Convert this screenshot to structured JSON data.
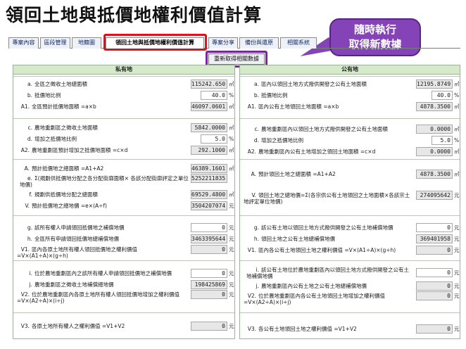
{
  "title": "領回土地與抵價地權利價值計算",
  "tabs": [
    "專案內容",
    "區段管理",
    "地籍圖",
    "領回土地與抵價地權利價值計算",
    "專案分享",
    "備份與還原",
    "相關系統"
  ],
  "callout": {
    "line1": "隨時執行",
    "line2": "取得新數據"
  },
  "refresh_button": "重新取得相關數據",
  "left": {
    "title": "私有地",
    "rows": [
      {
        "code": "a.",
        "label": "全區之徵收土地總面積",
        "value": "115242.650",
        "unit": "㎡"
      },
      {
        "code": "b.",
        "label": "抵價地比例",
        "value": "40.0",
        "unit": "%"
      },
      {
        "code": "A1.",
        "label": "全區預計抵價地面積 =a×b",
        "value": "46097.0601",
        "unit": "㎡"
      },
      {
        "code": "c.",
        "label": "農地重劃區之徵收土地面積",
        "value": "5842.0000",
        "unit": "㎡"
      },
      {
        "code": "d.",
        "label": "增加之抵價地比例",
        "value": "5.0",
        "unit": "%"
      },
      {
        "code": "A2.",
        "label": "農地重劃區預計增加之抵價地面積 =c×d",
        "value": "292.1000",
        "unit": "㎡"
      },
      {
        "code": "A.",
        "label": "預計抵價地之總面積 =A1+A2",
        "value": "46389.1601",
        "unit": "㎡"
      },
      {
        "code": "e.",
        "label": "Σ(規劃供抵價地分配之各分配街廓面積× 各該分配街廓評定之單位地價)",
        "value": "5252211835",
        "unit": ""
      },
      {
        "code": "f.",
        "label": "規劃供抵價地分配之總面積",
        "value": "69529.4800",
        "unit": "㎡"
      },
      {
        "code": "V.",
        "label": "預計抵價地之總地價 =e×(A÷f)",
        "value": "3504207074",
        "unit": "元"
      },
      {
        "code": "g.",
        "label": "該所有權人申請領回抵價地之補償地價",
        "value": "0",
        "unit": "元"
      },
      {
        "code": "h.",
        "label": "全區所有申請領回抵價地總補償地價",
        "value": "3463395644",
        "unit": "元"
      },
      {
        "code": "V1.",
        "label": "區內各原土地所有權人領回抵價地之權利價值 =V×(A1÷A)×(g÷h)",
        "value": "0",
        "unit": "元"
      },
      {
        "code": "i.",
        "label": "位於農地重劃區內之該所有權人申請領回抵價地之補償地價",
        "value": "0",
        "unit": "元"
      },
      {
        "code": "j.",
        "label": "農地重劃區之徵收土地補償總地價",
        "value": "198425869",
        "unit": "元"
      },
      {
        "code": "V2.",
        "label": "位於農地重劃區內各原土地所有權人領回抵價地增加之權利價值 =V×(A2÷A)×(i÷j)",
        "value": "0",
        "unit": "元"
      },
      {
        "code": "V3.",
        "label": "各原土地所有權人之權利價值 =V1+V2",
        "value": "0",
        "unit": "元"
      }
    ]
  },
  "right": {
    "title": "公有地",
    "rows": [
      {
        "code": "a.",
        "label": "區內以領回土地方式撥供開發之公有土地面積",
        "value": "12195.8749",
        "unit": "㎡"
      },
      {
        "code": "b.",
        "label": "抵價地比例",
        "value": "40.0",
        "unit": "%"
      },
      {
        "code": "A1.",
        "label": "區內公有土地領回土地面積 =a×b",
        "value": "4878.3500",
        "unit": "㎡"
      },
      {
        "code": "c.",
        "label": "農地重劃區內以領回土地方式撥供開發之公有土地面積",
        "value": "0.0000",
        "unit": "㎡"
      },
      {
        "code": "d.",
        "label": "增加之抵價地比例",
        "value": "5.0",
        "unit": "%"
      },
      {
        "code": "A2.",
        "label": "農地重劃區內公有土地增加之領回土地面積 =c×d",
        "value": "0.0000",
        "unit": "㎡"
      },
      {
        "code": "A.",
        "label": "預計領回土地之總面積 =A1+A2",
        "value": "4878.3500",
        "unit": "㎡"
      },
      {
        "code": "V.",
        "label": "領回土地之總地價=Σ(各宗供公有土地領回之土地面積×各該宗土地評定單位地價)",
        "value": "274095642",
        "unit": "元"
      },
      {
        "code": "g.",
        "label": "該公有土地以領回土地方式撥供開發之公有土地補償地價",
        "value": "0",
        "unit": "元"
      },
      {
        "code": "h.",
        "label": "領回土地之公有土地總補償地價",
        "value": "369401958",
        "unit": "元"
      },
      {
        "code": "V1.",
        "label": "區內各公有土地領回土地之權利價值 =V×(A1÷A)×(g÷h)",
        "value": "0",
        "unit": "元"
      },
      {
        "code": "i.",
        "label": "該公有土地位於農地重劃區內以領回土地方式撥供開發之公有土地補償地價",
        "value": "0",
        "unit": "元"
      },
      {
        "code": "j.",
        "label": "農地重劃區內公有土地之公有土地總補償地價",
        "value": "0",
        "unit": "元"
      },
      {
        "code": "V2.",
        "label": "位於農地重劃區內各公有土地領回土地增加之權利價值 =V×(A2÷A)×(i÷j)",
        "value": "0",
        "unit": "元"
      },
      {
        "code": "V3.",
        "label": "各公有土地領回土地之權利價值 =V1+V2",
        "value": "0",
        "unit": "元"
      }
    ]
  }
}
